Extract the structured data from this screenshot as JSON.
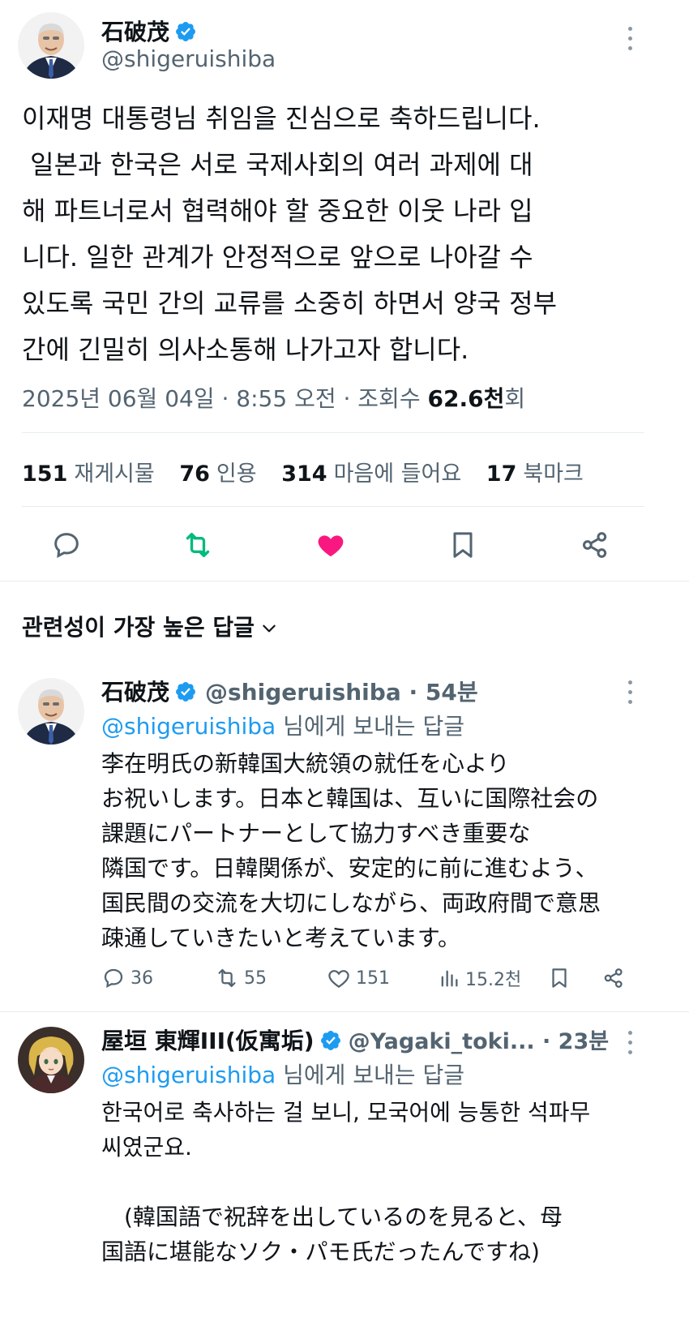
{
  "main_tweet": {
    "display_name": "石破茂",
    "handle": "@shigeruishiba",
    "text": "이재명 대통령님 취임을 진심으로 축하드립니다.\n 일본과 한국은 서로 국제사회의 여러 과제에 대\n해 파트너로서 협력해야 할 중요한 이웃 나라 입\n니다. 일한 관계가 안정적으로 앞으로 나아갈 수\n있도록 국민 간의 교류를 소중히 하면서 양국 정부\n간에 긴밀히 의사소통해 나가고자 합니다.",
    "meta_prefix": "2025년 06월 04일 · 8:55 오전 · 조회수 ",
    "views": "62.6천",
    "views_suffix": "회",
    "stats": {
      "retweets": "151",
      "retweets_label": "재게시물",
      "quotes": "76",
      "quotes_label": "인용",
      "likes": "314",
      "likes_label": "마음에 들어요",
      "bookmarks": "17",
      "bookmarks_label": "북마크"
    }
  },
  "replies_header": "관련성이 가장 높은 답글",
  "replies": [
    {
      "display_name": "石破茂",
      "handle_time": "@shigeruishiba · 54분",
      "reply_mention": "@shigeruishiba",
      "reply_suffix": " 님에게 보내는 답글",
      "text": "李在明氏の新韓国大統領の就任を心より\nお祝いします。日本と韓国は、互いに国際社会の\n課題にパートナーとして協力すべき重要な\n隣国です。日韓関係が、安定的に前に進むよう、\n国民間の交流を大切にしながら、両政府間で意思\n疎通していきたいと考えています。",
      "comments": "36",
      "retweets": "55",
      "likes": "151",
      "views": "15.2천"
    },
    {
      "display_name": "屋垣 東輝III(仮寓垢)",
      "handle_time": "@Yagaki_toki... · 23분",
      "reply_mention": "@shigeruishiba",
      "reply_suffix": " 님에게 보내는 답글",
      "text": "한국어로 축사하는 걸 보니, 모국어에 능통한 석파무\n씨였군요.\n\n　(韓国語で祝辞を出しているのを見ると、母\n国語に堪能なソク・パモ氏だったんですね)"
    }
  ],
  "colors": {
    "accent": "#1d9bf0",
    "retweet_active": "#00ba7c",
    "like_active": "#f91880",
    "secondary_text": "#536471"
  }
}
